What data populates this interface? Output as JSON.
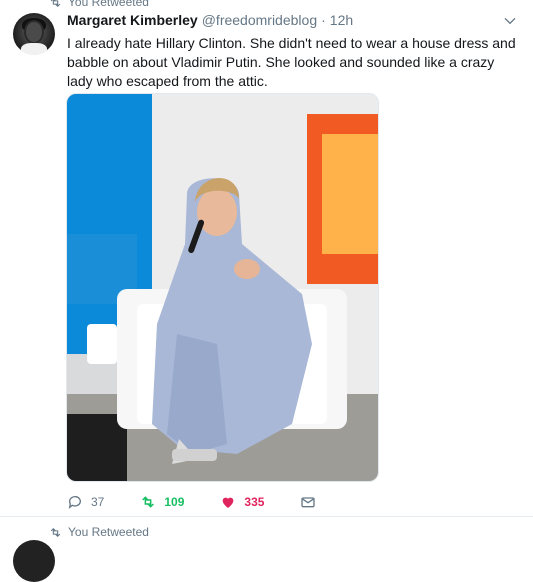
{
  "retweet_banner": {
    "label": "You Retweeted"
  },
  "tweet": {
    "author_name": "Margaret Kimberley",
    "author_handle": "@freedomrideblog",
    "separator": "·",
    "time": "12h",
    "text": "I already hate Hillary Clinton. She didn't need to wear a house dress and babble on about Vladimir Putin. She looked and sounded like a crazy lady who escaped from the attic.",
    "actions": {
      "replies": "37",
      "retweets": "109",
      "likes": "335"
    }
  },
  "next_retweet_banner": {
    "label": "You Retweeted"
  },
  "colors": {
    "retweet_green": "#17bf63",
    "like_red": "#e0245e",
    "meta_gray": "#657786",
    "divider": "#e6ecf0"
  },
  "icons": [
    "retweet-icon",
    "chevron-down-icon",
    "reply-icon",
    "retweet-icon",
    "heart-icon",
    "message-icon"
  ]
}
